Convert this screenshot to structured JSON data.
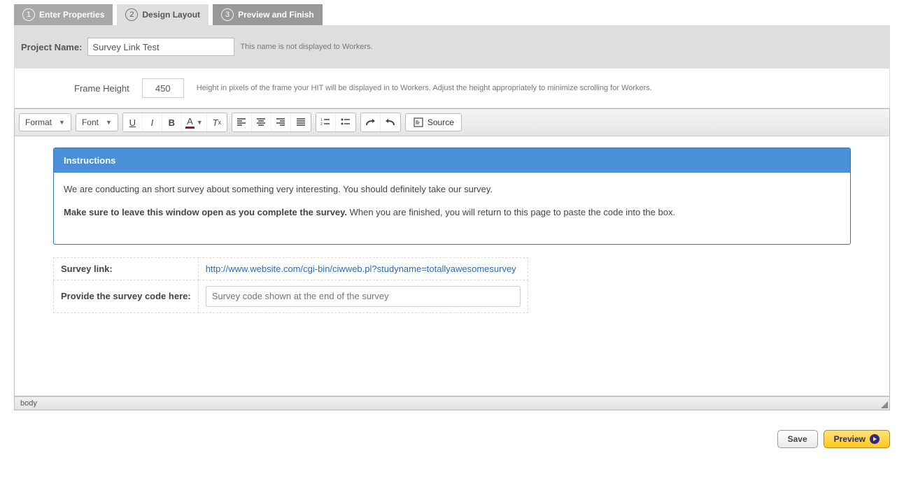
{
  "wizard": {
    "steps": [
      {
        "num": "1",
        "label": "Enter Properties"
      },
      {
        "num": "2",
        "label": "Design Layout"
      },
      {
        "num": "3",
        "label": "Preview and Finish"
      }
    ]
  },
  "project": {
    "label": "Project Name:",
    "value": "Survey Link Test",
    "hint": "This name is not displayed to Workers."
  },
  "frame": {
    "label": "Frame Height",
    "value": "450",
    "hint": "Height in pixels of the frame your HIT will be displayed in to Workers. Adjust the height appropriately to minimize scrolling for Workers."
  },
  "toolbar": {
    "format": "Format",
    "font": "Font",
    "source": "Source"
  },
  "content": {
    "panel_title": "Instructions",
    "p1": "We are conducting an short survey about something very interesting.  You should definitely take our survey.",
    "p2_bold": "Make sure to leave this window open as you complete the survey.",
    "p2_rest": " When you are finished, you will return to this page to paste the code into the box.",
    "row1_label": "Survey link:",
    "row1_link": "http://www.website.com/cgi-bin/ciwweb.pl?studyname=totallyawesomesurvey",
    "row2_label": "Provide the survey code here:",
    "row2_placeholder": "Survey code shown at the end of the survey"
  },
  "pathbar": "body",
  "footer": {
    "save": "Save",
    "preview": "Preview"
  }
}
